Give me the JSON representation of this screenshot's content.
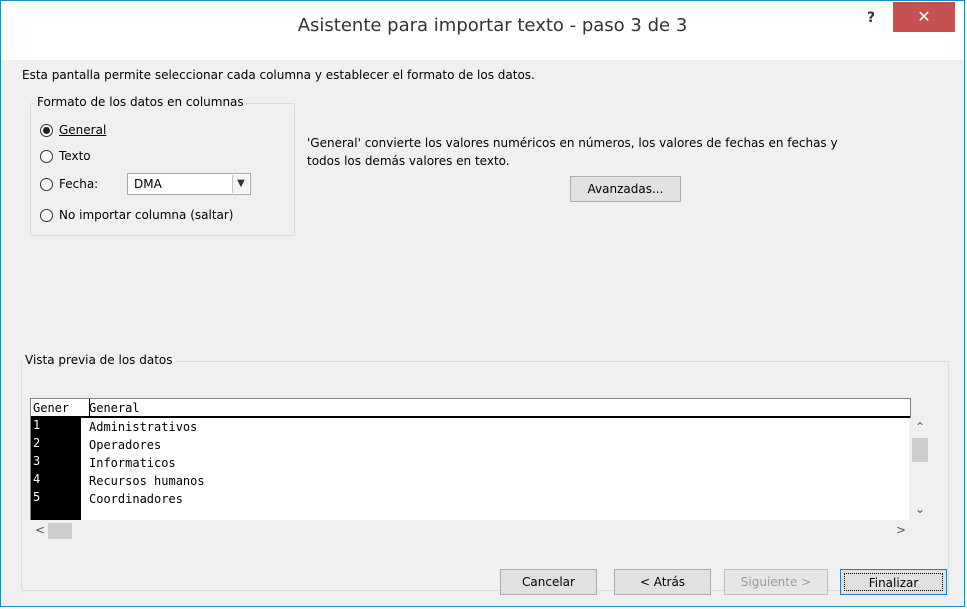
{
  "window": {
    "title": "Asistente para importar texto - paso 3 de 3",
    "help_label": "?",
    "close_label": "✕"
  },
  "intro_text": "Esta pantalla permite seleccionar cada columna y establecer el formato de los datos.",
  "column_format": {
    "group_label": "Formato de los datos en columnas",
    "options": [
      {
        "label": "General",
        "checked": true
      },
      {
        "label": "Texto",
        "checked": false
      },
      {
        "label": "Fecha:",
        "checked": false
      },
      {
        "label": "No importar columna (saltar)",
        "checked": false
      }
    ],
    "date_format_value": "DMA"
  },
  "description_line1": "'General' convierte los valores numéricos en números, los valores de fechas en fechas y",
  "description_line2": "todos los demás valores en texto.",
  "advanced_button": "Avanzadas...",
  "preview": {
    "group_label": "Vista previa de los datos",
    "headers": [
      "Gener",
      "General"
    ],
    "rows": [
      [
        "1",
        "Administrativos"
      ],
      [
        "2",
        "Operadores"
      ],
      [
        "3",
        "Informaticos"
      ],
      [
        "4",
        "Recursos humanos"
      ],
      [
        "5",
        "Coordinadores"
      ]
    ]
  },
  "buttons": {
    "cancel": "Cancelar",
    "back": "< Atrás",
    "next": "Siguiente >",
    "finish": "Finalizar"
  },
  "colors": {
    "title_border": "#1e88c8",
    "close_button": "#c75050",
    "dialog_bg": "#f0f0f0"
  }
}
